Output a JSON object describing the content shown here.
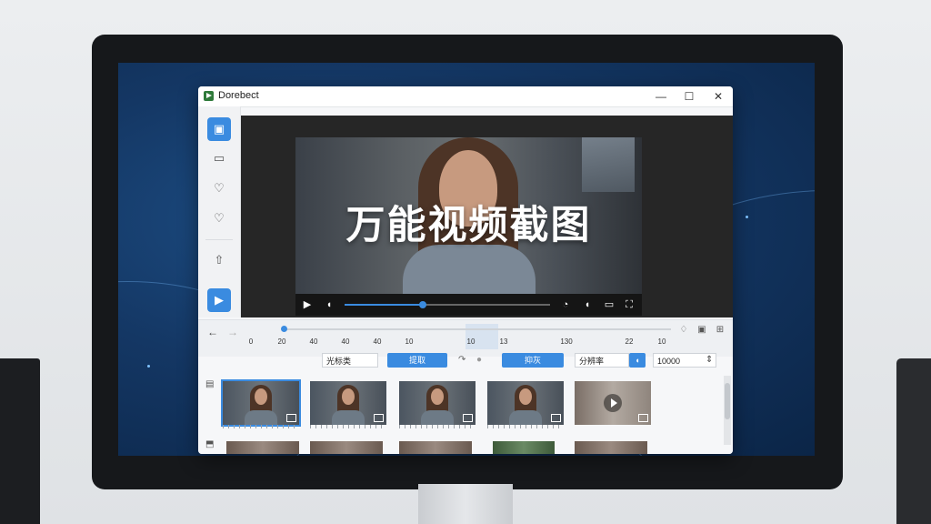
{
  "app": {
    "title": "Dorebect"
  },
  "window_controls": {
    "minimize": "—",
    "maximize": "☐",
    "close": "✕"
  },
  "sidebar": {
    "items": [
      {
        "name": "image",
        "glyph": "▣",
        "active": true
      },
      {
        "name": "comment",
        "glyph": "▭"
      },
      {
        "name": "tag",
        "glyph": "♡"
      },
      {
        "name": "favorite",
        "glyph": "♡"
      },
      {
        "name": "export",
        "glyph": "⇧"
      },
      {
        "name": "play",
        "glyph": "▶",
        "active": true
      }
    ]
  },
  "player": {
    "overlay_title": "万能视频截图",
    "progress": 0.38,
    "controls": {
      "play": "▶",
      "volume": "◖",
      "sound": "◔",
      "captions": "▭",
      "fullscreen": "⛶"
    }
  },
  "timeline": {
    "back": "←",
    "forward": "→",
    "ticks": [
      "0",
      "20",
      "40",
      "40",
      "40",
      "10",
      "10",
      "13",
      "130",
      "22",
      "10"
    ],
    "position": 0.0
  },
  "toolbar": {
    "field1_value": "光标类",
    "button1_label": "提取",
    "button2_label": "抑灰",
    "select_value": "分辨率",
    "number_value": "10000",
    "stepper": "⇕"
  },
  "thumbnails": {
    "row1": [
      "frame-1",
      "frame-2",
      "frame-3",
      "frame-4",
      "frame-5"
    ],
    "selected_index": 0
  },
  "colors": {
    "accent": "#3a8be0",
    "desktop": "#143764"
  }
}
